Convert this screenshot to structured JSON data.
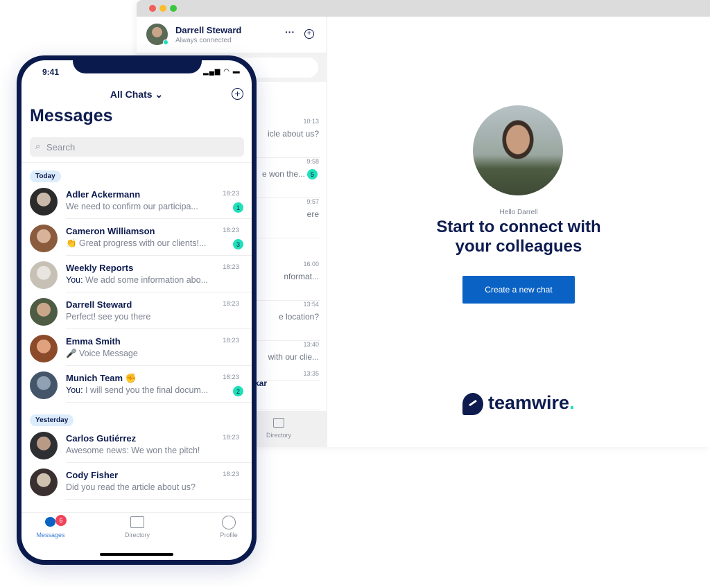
{
  "desktop": {
    "user": {
      "name": "Darrell Steward",
      "status": "Always connected"
    },
    "rows": [
      {
        "time": "10:13",
        "preview": "icle about us?",
        "badge": null,
        "name": ""
      },
      {
        "time": "9:58",
        "preview": "e won the...",
        "badge": "5",
        "name": ""
      },
      {
        "time": "9:57",
        "preview": "ere",
        "badge": null,
        "name": ""
      },
      {
        "time": "16:00",
        "preview": "nformat...",
        "badge": null,
        "name": ""
      },
      {
        "time": "13:54",
        "preview": "e location?",
        "badge": null,
        "name": ""
      },
      {
        "time": "13:40",
        "preview": "with our clie...",
        "badge": null,
        "name": ""
      },
      {
        "time": "13:35",
        "preview": "",
        "badge": null,
        "name": "kar"
      }
    ],
    "tab_directory": "Directory",
    "greeting": "Hello Darrell",
    "headline_1": "Start to connect with",
    "headline_2": "your colleagues",
    "create_chat": "Create a new chat",
    "logo_text": "teamwire",
    "logo_dot": ".",
    "colors": {
      "accent": "#0a62c4",
      "navy": "#0d1b4f",
      "badge": "#1fe0b8",
      "alert": "#f0435a"
    }
  },
  "phone": {
    "time": "9:41",
    "filter": "All Chats",
    "title": "Messages",
    "search_placeholder": "Search",
    "today": "Today",
    "yesterday": "Yesterday",
    "chats_today": [
      {
        "name": "Adler Ackermann",
        "you": "",
        "preview": "We need to confirm our participa...",
        "time": "18:23",
        "badge": "1"
      },
      {
        "name": "Cameron Williamson",
        "you": "",
        "preview": "👏 Great progress with our clients!...",
        "time": "18:23",
        "badge": "3"
      },
      {
        "name": "Weekly Reports",
        "you": "You:",
        "preview": " We add some information abo...",
        "time": "18:23",
        "badge": null
      },
      {
        "name": "Darrell Steward",
        "you": "",
        "preview": "Perfect! see you there",
        "time": "18:23",
        "badge": null
      },
      {
        "name": "Emma Smith",
        "you": "",
        "preview": "🎤 Voice Message",
        "time": "18:23",
        "badge": null
      },
      {
        "name": "Munich Team ✊",
        "you": "You:",
        "preview": " I will send you the final docum...",
        "time": "18:23",
        "badge": "2"
      }
    ],
    "chats_yesterday": [
      {
        "name": "Carlos Gutiérrez",
        "you": "",
        "preview": "Awesome news: We won the pitch!",
        "time": "18:23",
        "badge": null
      },
      {
        "name": "Cody Fisher",
        "you": "",
        "preview": "Did you read the article about us?",
        "time": "18:23",
        "badge": null
      }
    ],
    "tabs": {
      "messages": "Messages",
      "messages_badge": "6",
      "directory": "Directory",
      "profile": "Profile"
    }
  }
}
